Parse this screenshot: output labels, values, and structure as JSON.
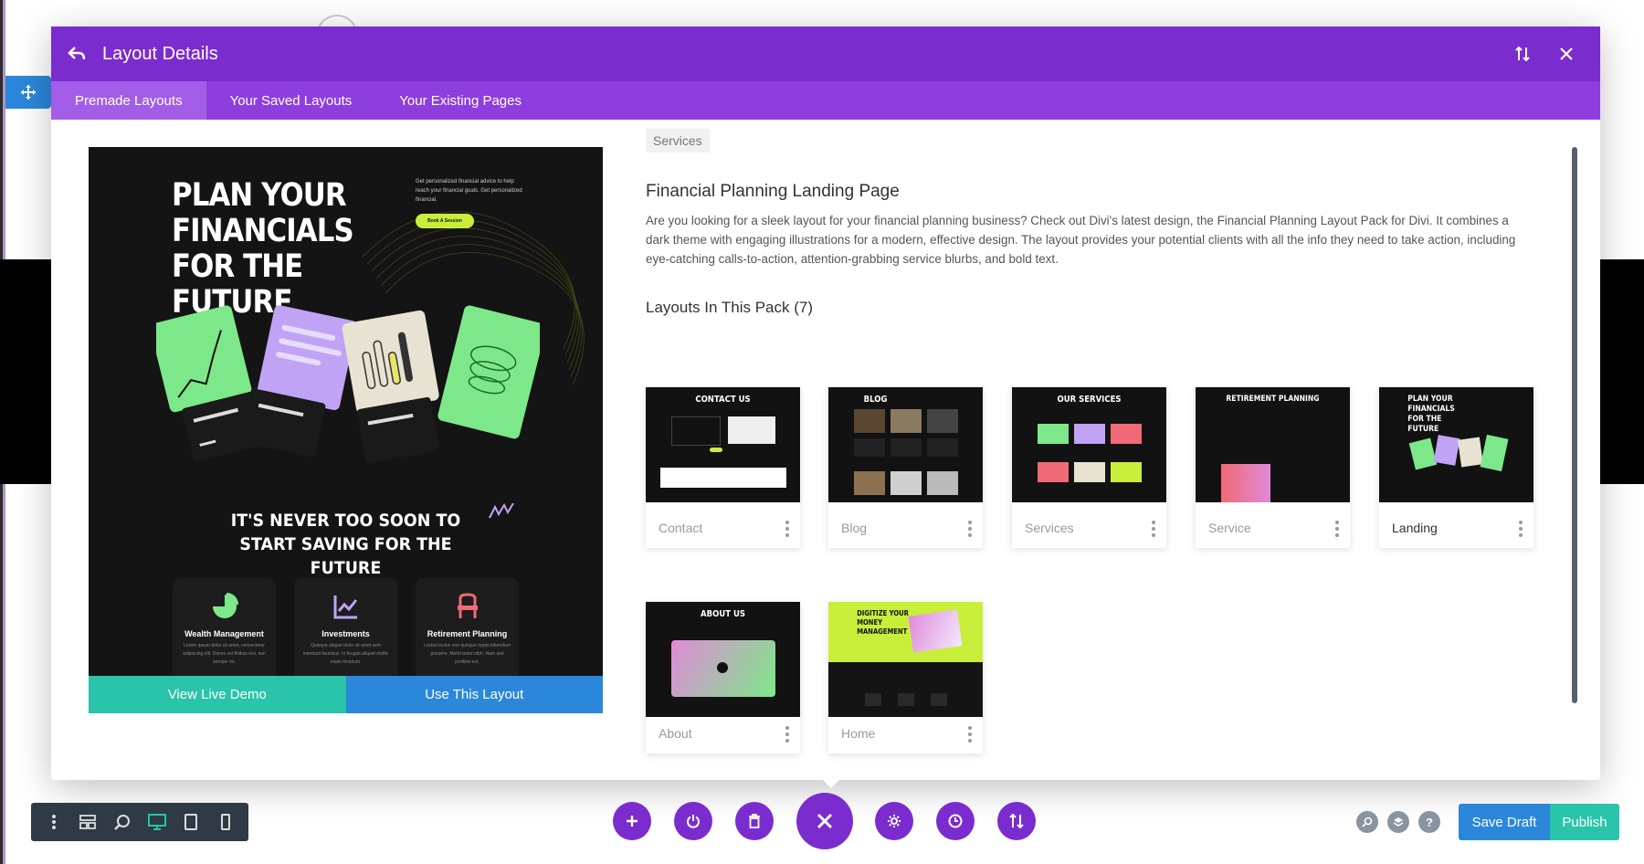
{
  "modal": {
    "title": "Layout Details",
    "tabs": [
      {
        "label": "Premade Layouts",
        "active": true
      },
      {
        "label": "Your Saved Layouts",
        "active": false
      },
      {
        "label": "Your Existing Pages",
        "active": false
      }
    ]
  },
  "preview": {
    "headline": "PLAN YOUR FINANCIALS FOR THE FUTURE",
    "intro": "Get personalized financial advice to help reach your financial goals. Get personalized financial.",
    "cta": "Book A Session",
    "slogan": "IT'S NEVER TOO SOON TO START SAVING FOR THE FUTURE",
    "services": [
      {
        "title": "Wealth Management",
        "text": "Lorem ipsum dolor sit amet, consectetur adipiscing elit. Donec vel finibus nisi, non semper mi."
      },
      {
        "title": "Investments",
        "text": "Quisque aliquet dolor sit amet sem interdum faucibus. In feugiat aliquet mollis etiam tincidunt."
      },
      {
        "title": "Retirement Planning",
        "text": "Luctus lectus non quisque turpis bibendum posuere. Morbi tortor nibh. Nam sed porttitor est."
      }
    ],
    "view_demo": "View Live Demo",
    "use_layout": "Use This Layout"
  },
  "detail": {
    "category": "Services",
    "title": "Financial Planning Landing Page",
    "description": "Are you looking for a sleek layout for your financial planning business? Check out Divi's latest design, the Financial Planning Layout Pack for Divi. It combines a dark theme with engaging illustrations for a modern, effective design. The layout provides your potential clients with all the info they need to take action, including eye-catching calls-to-action, attention-grabbing service blurbs, and bold text.",
    "pack_heading": "Layouts In This Pack (7)",
    "layouts": [
      {
        "label": "Contact",
        "header": "CONTACT US"
      },
      {
        "label": "Blog",
        "header": "BLOG"
      },
      {
        "label": "Services",
        "header": "OUR SERVICES"
      },
      {
        "label": "Service",
        "header": "RETIREMENT PLANNING"
      },
      {
        "label": "Landing",
        "header": "PLAN YOUR FINANCIALS FOR THE FUTURE"
      },
      {
        "label": "About",
        "header": "ABOUT US"
      },
      {
        "label": "Home",
        "header": "DIGITIZE YOUR MONEY MANAGEMENT"
      }
    ]
  },
  "footer": {
    "save_draft": "Save Draft",
    "publish": "Publish",
    "help": "?"
  },
  "colors": {
    "accent_purple": "#7b2ccf",
    "tab_purple": "#8e3ede",
    "blue": "#2b87da",
    "teal": "#29c4a9",
    "lime": "#c9ee3a",
    "mint": "#7de88a"
  }
}
